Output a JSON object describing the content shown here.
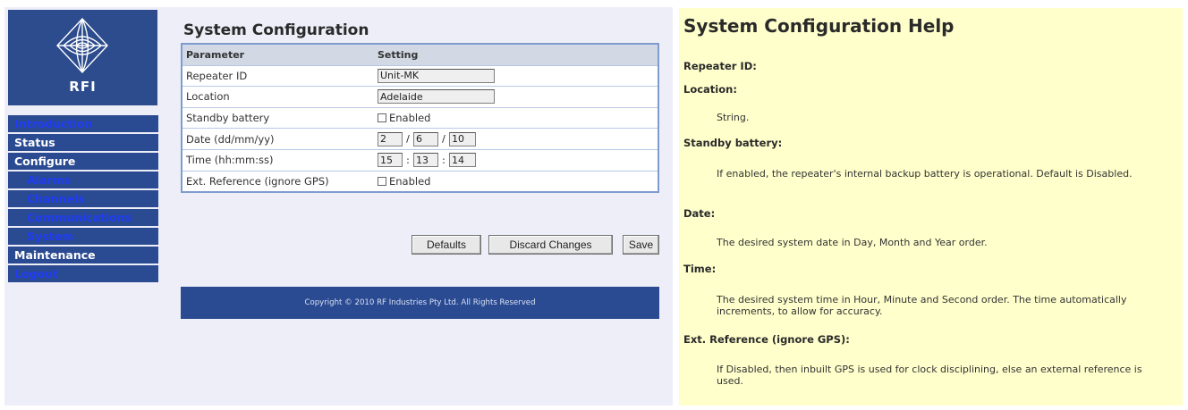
{
  "logo": {
    "text": "RFI"
  },
  "nav": {
    "items": [
      {
        "label": "Introduction"
      },
      {
        "label": "Status"
      },
      {
        "label": "Configure"
      },
      {
        "label": "Alarms"
      },
      {
        "label": "Channels"
      },
      {
        "label": "Communications"
      },
      {
        "label": "System"
      },
      {
        "label": "Maintenance"
      },
      {
        "label": "Logout"
      }
    ]
  },
  "main": {
    "title": "System Configuration",
    "table": {
      "header": {
        "parameter": "Parameter",
        "setting": "Setting"
      },
      "rows": [
        {
          "label": "Repeater ID",
          "value": "Unit-MK"
        },
        {
          "label": "Location",
          "value": "Adelaide"
        },
        {
          "label": "Standby battery",
          "checkbox_label": "Enabled",
          "checked": false
        },
        {
          "label": "Date (dd/mm/yy)",
          "day": "2",
          "month": "6",
          "year": "10",
          "sep": "/"
        },
        {
          "label": "Time (hh:mm:ss)",
          "hour": "15",
          "minute": "13",
          "second": "14",
          "sep": ":"
        },
        {
          "label": "Ext. Reference (ignore GPS)",
          "checkbox_label": "Enabled",
          "checked": false
        }
      ]
    },
    "buttons": {
      "defaults": "Defaults",
      "discard": "Discard Changes",
      "save": "Save"
    },
    "footer": "Copyright © 2010 RF Industries Pty Ltd. All Rights Reserved"
  },
  "help": {
    "title": "System Configuration Help",
    "sections": [
      {
        "heading": "Repeater ID:"
      },
      {
        "heading": "Location:",
        "text": "String."
      },
      {
        "heading": "Standby battery:",
        "text": "If enabled, the repeater's internal backup battery is operational. Default is Disabled."
      },
      {
        "heading": "Date:",
        "text": "The desired system date in Day, Month and Year order."
      },
      {
        "heading": "Time:",
        "text": "The desired system time in Hour, Minute and Second order. The time automatically increments, to allow for accuracy."
      },
      {
        "heading": "Ext. Reference (ignore GPS):",
        "text": "If Disabled, then inbuilt GPS is used for clock disciplining, else an external reference is used."
      }
    ]
  },
  "colors": {
    "nav_bg": "#2a4a91",
    "nav_link": "#1f3cf2",
    "help_bg": "#ffffcc",
    "table_border": "#7f9ccf"
  }
}
